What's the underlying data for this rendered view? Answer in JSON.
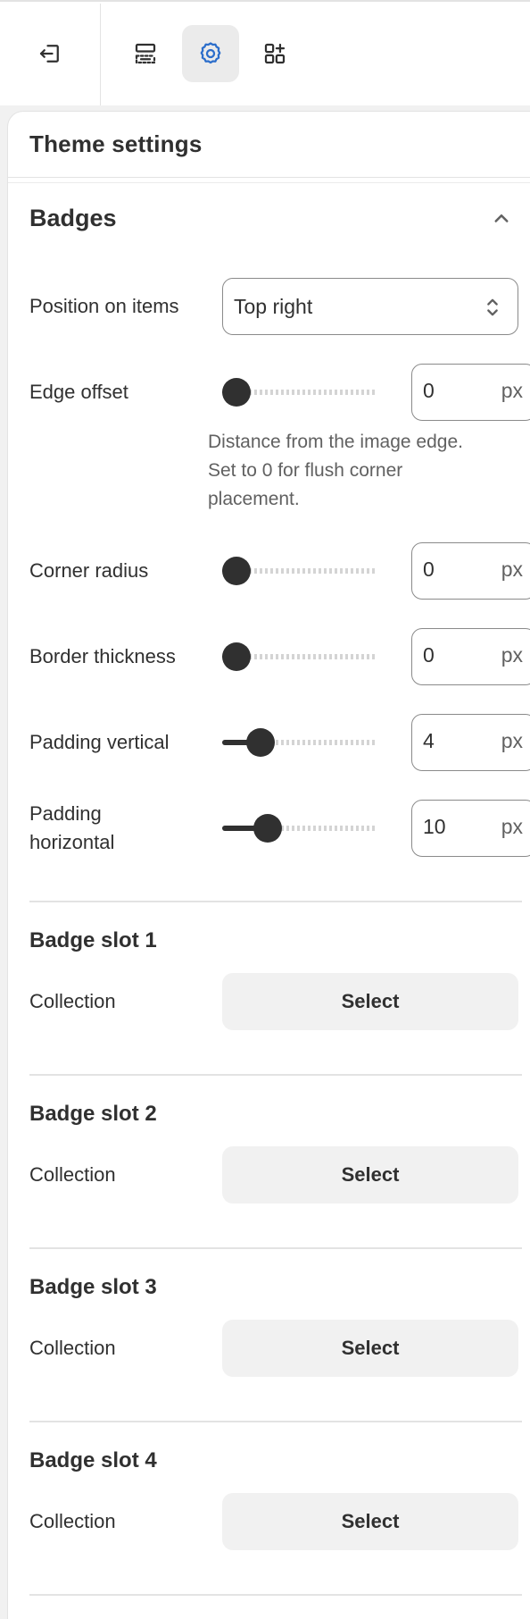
{
  "toolbar": {
    "icons": [
      "exit-icon",
      "sections-icon",
      "gear-icon",
      "apps-icon"
    ],
    "active": "gear-icon",
    "active_color": "#2c6ecb"
  },
  "panel": {
    "title": "Theme settings"
  },
  "section": {
    "title": "Badges",
    "expanded": true
  },
  "position": {
    "label": "Position on items",
    "value": "Top right"
  },
  "edge_offset": {
    "label": "Edge offset",
    "value": "0",
    "unit": "px",
    "level": 0,
    "help_lines": [
      "Distance from the image edge.",
      "Set to 0 for flush corner",
      "placement."
    ]
  },
  "corner_radius": {
    "label": "Corner radius",
    "value": "0",
    "unit": "px",
    "level": 0
  },
  "border_thickness": {
    "label": "Border thickness",
    "value": "0",
    "unit": "px",
    "level": 0
  },
  "padding_vertical": {
    "label": "Padding vertical",
    "value": "4",
    "unit": "px",
    "level": 0.17
  },
  "padding_horizontal": {
    "label_line1": "Padding",
    "label_line2": "horizontal",
    "value": "10",
    "unit": "px",
    "level": 0.22
  },
  "slots": [
    {
      "title": "Badge slot 1",
      "field_label": "Collection",
      "button": "Select"
    },
    {
      "title": "Badge slot 2",
      "field_label": "Collection",
      "button": "Select"
    },
    {
      "title": "Badge slot 3",
      "field_label": "Collection",
      "button": "Select"
    },
    {
      "title": "Badge slot 4",
      "field_label": "Collection",
      "button": "Select"
    }
  ]
}
